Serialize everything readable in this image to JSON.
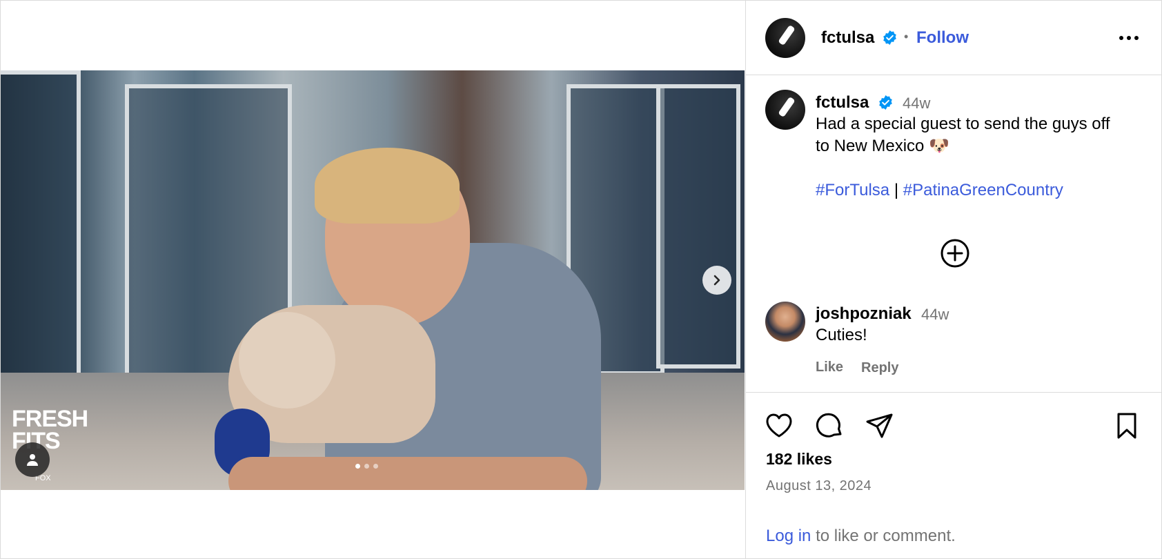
{
  "post": {
    "username": "fctulsa",
    "follow_label": "Follow",
    "time_ago": "44w",
    "caption_line1": "Had a special guest to send the guys off",
    "caption_line2": "to New Mexico 🐶",
    "hashtag1": "#ForTulsa",
    "separator": "|",
    "hashtag2": "#PatinaGreenCountry",
    "likes": "182 likes",
    "date": "August 13, 2024"
  },
  "comment": {
    "username": "joshpozniak",
    "time_ago": "44w",
    "text": "Cuties!",
    "like_label": "Like",
    "reply_label": "Reply"
  },
  "login_prompt": {
    "link": "Log in",
    "text": "to like or comment."
  },
  "media": {
    "brand_logo_text": "FRESH FITS",
    "brand_logo_sub": "FOX CLEANERS",
    "carousel_count": 3,
    "carousel_active": 1
  },
  "colors": {
    "link": "#3b5bdb",
    "verified": "#0095f6",
    "muted": "#737373",
    "border": "#dbdbdb"
  },
  "icons": [
    "verified-badge-icon",
    "more-options-icon",
    "add-circle-icon",
    "heart-icon",
    "comment-icon",
    "share-icon",
    "bookmark-icon",
    "chevron-right-icon",
    "user-tag-icon"
  ]
}
